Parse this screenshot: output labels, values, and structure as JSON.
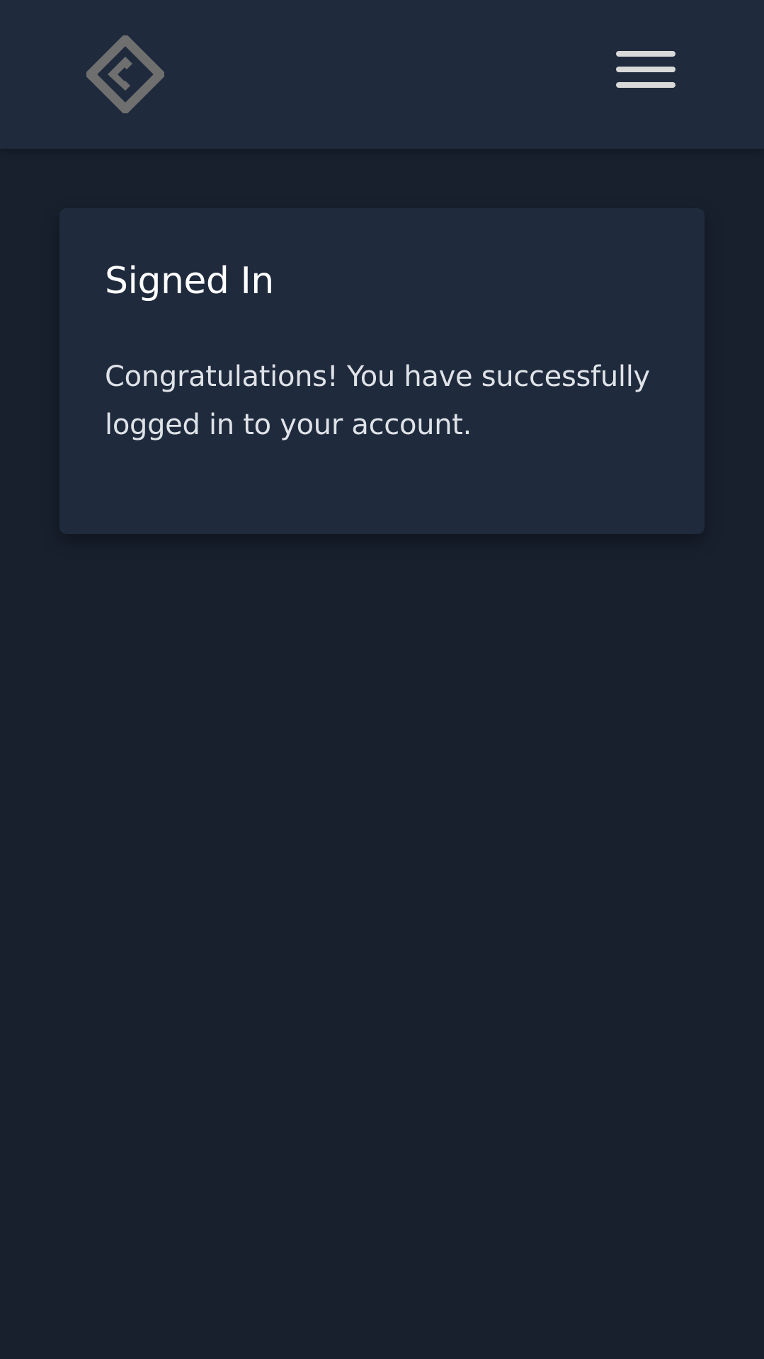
{
  "header": {
    "logo_icon": "brand-diamond-logo-icon",
    "menu_icon": "hamburger-menu-icon"
  },
  "card": {
    "title": "Signed In",
    "message": "Congratulations! You have successfully logged in to your account."
  },
  "colors": {
    "page_background": "#18202e",
    "surface": "#1f2b3d",
    "logo": "#6f6f6f",
    "menu_icon": "#d9d9d9"
  }
}
